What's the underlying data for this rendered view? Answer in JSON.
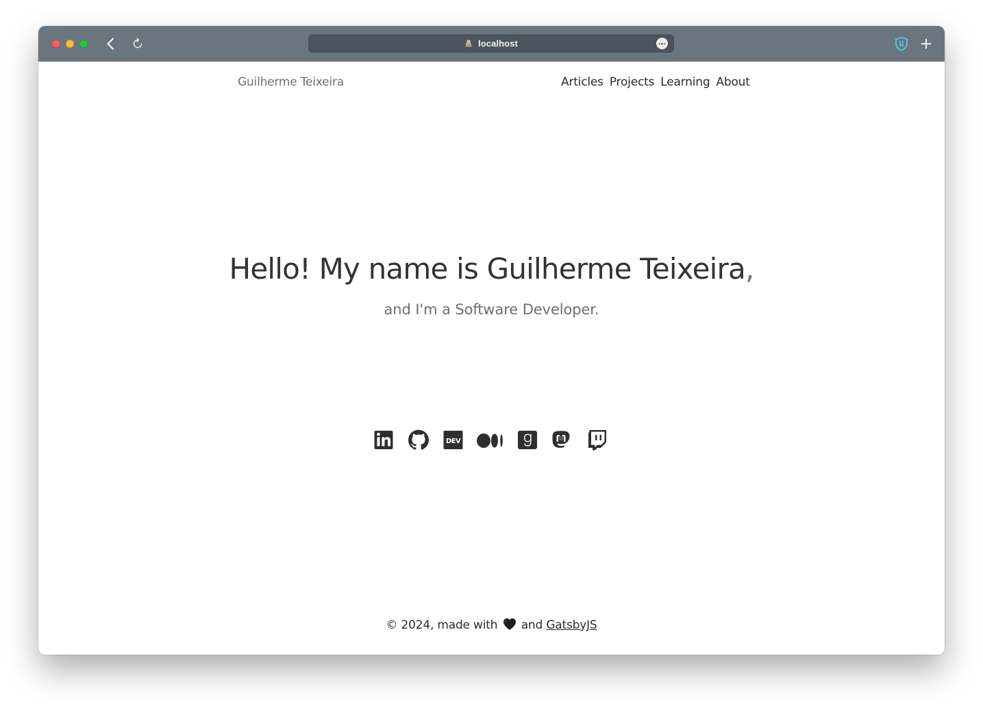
{
  "browser": {
    "url": "localhost",
    "url_icon": "tab-favicon-icon",
    "controls": [
      "back-icon",
      "reload-icon",
      "more-options-icon",
      "shield-extension-icon",
      "new-tab-plus-icon"
    ]
  },
  "header": {
    "site_title": "Guilherme Teixeira",
    "nav": [
      {
        "label": "Articles"
      },
      {
        "label": "Projects"
      },
      {
        "label": "Learning"
      },
      {
        "label": "About"
      }
    ]
  },
  "hero": {
    "title": "Hello! My name is Guilherme Teixeira",
    "title_punctuation": ",",
    "subtitle": "and I'm a Software Developer."
  },
  "social_links": [
    {
      "icon": "linkedin-icon"
    },
    {
      "icon": "github-icon"
    },
    {
      "icon": "dev-icon"
    },
    {
      "icon": "medium-icon"
    },
    {
      "icon": "goodreads-icon"
    },
    {
      "icon": "mastodon-icon"
    },
    {
      "icon": "twitch-icon"
    }
  ],
  "footer": {
    "prefix": "© 2024, made with",
    "heart_icon": "black-heart-icon",
    "conjunction": "and",
    "link_label": "GatsbyJS"
  },
  "colors": {
    "titlebar": "#6b757e",
    "urlbar": "#4b545c",
    "text": "#333333",
    "muted": "#6b6f74",
    "icon": "#2f2f2f",
    "shield_accent": "#4fc3e0"
  }
}
